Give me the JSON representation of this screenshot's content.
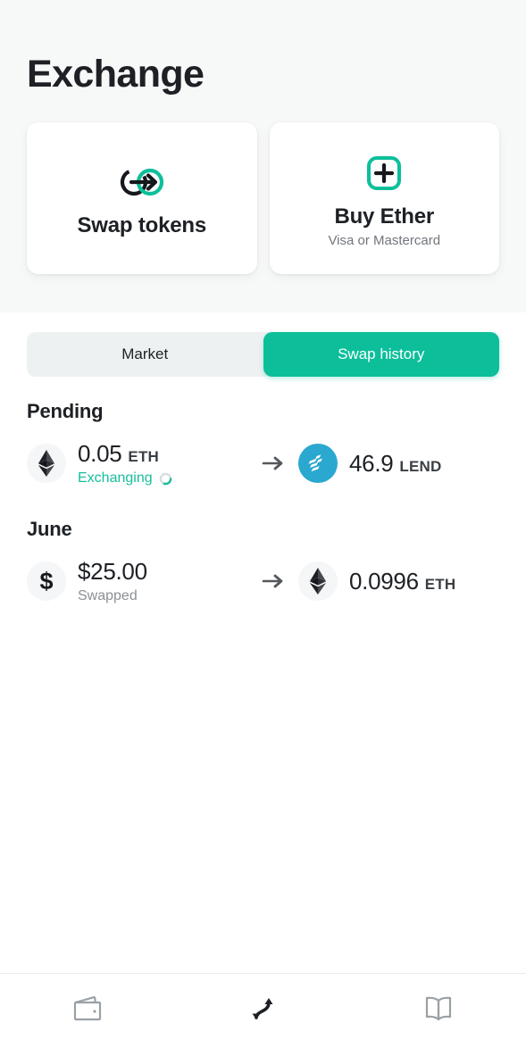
{
  "header": {
    "title": "Exchange",
    "cards": [
      {
        "icon": "swap-tokens-icon",
        "title": "Swap tokens",
        "subtitle": ""
      },
      {
        "icon": "plus-square-icon",
        "title": "Buy Ether",
        "subtitle": "Visa or Mastercard"
      }
    ]
  },
  "tabs": [
    {
      "label": "Market",
      "active": false
    },
    {
      "label": "Swap history",
      "active": true
    }
  ],
  "history": {
    "groups": [
      {
        "title": "Pending",
        "rows": [
          {
            "from": {
              "icon": "ethereum-icon",
              "amount": "0.05",
              "symbol": "ETH",
              "status": "Exchanging",
              "status_type": "pending"
            },
            "separator": "arrow-right-icon",
            "to": {
              "icon": "lend-icon",
              "amount": "46.9",
              "symbol": "LEND",
              "status": "",
              "status_type": ""
            }
          }
        ]
      },
      {
        "title": "June",
        "rows": [
          {
            "from": {
              "icon": "dollar-icon",
              "amount": "$25.00",
              "symbol": "",
              "status": "Swapped",
              "status_type": "done"
            },
            "separator": "arrow-right-icon",
            "to": {
              "icon": "ethereum-icon",
              "amount": "0.0996",
              "symbol": "ETH",
              "status": "",
              "status_type": ""
            }
          }
        ]
      }
    ]
  },
  "bottom_nav": [
    {
      "icon": "wallet-icon",
      "active": false
    },
    {
      "icon": "exchange-arrows-icon",
      "active": true
    },
    {
      "icon": "book-icon",
      "active": false
    }
  ],
  "colors": {
    "accent": "#0cbf9a",
    "accent_text": "#18bd9b",
    "text_primary": "#1d2024",
    "text_muted": "#8b9096",
    "header_bg": "#f7f8f8",
    "track_bg": "#eef1f2",
    "lend_blue": "#2aa8cf"
  }
}
